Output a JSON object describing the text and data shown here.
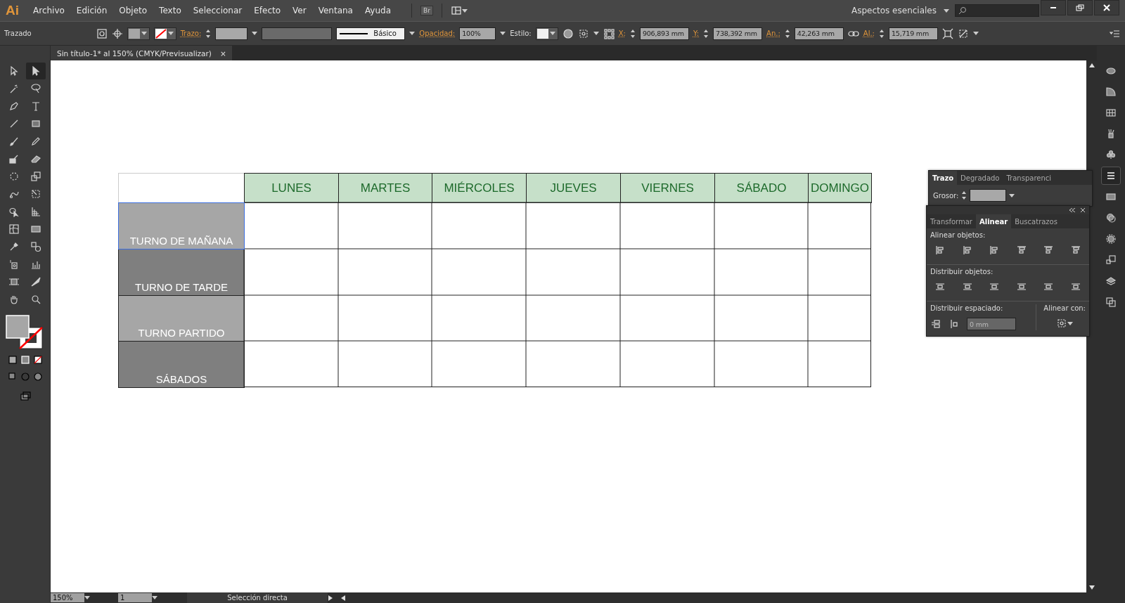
{
  "app": {
    "logo": "Ai",
    "menu": [
      "Archivo",
      "Edición",
      "Objeto",
      "Texto",
      "Seleccionar",
      "Efecto",
      "Ver",
      "Ventana",
      "Ayuda"
    ],
    "bridge": "Br",
    "workspace": "Aspectos esenciales"
  },
  "control_bar": {
    "selection": "Trazado",
    "stroke_label": "Trazo:",
    "preset": "Básico",
    "opacity_label": "Opacidad:",
    "opacity": "100%",
    "style_label": "Estilo:",
    "fields": [
      {
        "label": "X:",
        "value": "906,893 mm"
      },
      {
        "label": "Y:",
        "value": "738,392 mm"
      },
      {
        "label": "An.:",
        "value": "42,263 mm"
      },
      {
        "label": "Al.:",
        "value": "15,719 mm"
      }
    ]
  },
  "document_tab": {
    "title": "Sin título-1* al 150% (CMYK/Previsualizar)",
    "close": "×"
  },
  "tools": [
    {
      "kind": "selection",
      "selected": false
    },
    {
      "kind": "direct",
      "selected": true
    },
    {
      "kind": "wand",
      "selected": false
    },
    {
      "kind": "lasso",
      "selected": false
    },
    {
      "kind": "pen",
      "selected": false
    },
    {
      "kind": "type",
      "selected": false
    },
    {
      "kind": "line",
      "selected": false
    },
    {
      "kind": "rect",
      "selected": false
    },
    {
      "kind": "brush",
      "selected": false
    },
    {
      "kind": "pencil",
      "selected": false
    },
    {
      "kind": "blob",
      "selected": false
    },
    {
      "kind": "eraser",
      "selected": false
    },
    {
      "kind": "rotate",
      "selected": false
    },
    {
      "kind": "scale",
      "selected": false
    },
    {
      "kind": "warp",
      "selected": false
    },
    {
      "kind": "free",
      "selected": false
    },
    {
      "kind": "builder",
      "selected": false
    },
    {
      "kind": "perspective",
      "selected": false
    },
    {
      "kind": "mesh",
      "selected": false
    },
    {
      "kind": "gradient",
      "selected": false
    },
    {
      "kind": "eyedropper",
      "selected": false
    },
    {
      "kind": "blend",
      "selected": false
    },
    {
      "kind": "sprayer",
      "selected": false
    },
    {
      "kind": "graph",
      "selected": false
    },
    {
      "kind": "artboard",
      "selected": false
    },
    {
      "kind": "slice",
      "selected": false
    },
    {
      "kind": "hand",
      "selected": false
    },
    {
      "kind": "zoom",
      "selected": false
    }
  ],
  "table": {
    "columns": [
      "LUNES",
      "MARTES",
      "MIÉRCOLES",
      "JUEVES",
      "VIERNES",
      "SÁBADO",
      "DOMINGO"
    ],
    "rows": [
      {
        "label": "TURNO DE MAÑANA",
        "kind": "light",
        "selected": true
      },
      {
        "label": "TURNO DE TARDE",
        "kind": "dark",
        "selected": false
      },
      {
        "label": "TURNO PARTIDO",
        "kind": "light",
        "selected": false
      },
      {
        "label": "SÁBADOS",
        "kind": "dark",
        "selected": false
      }
    ]
  },
  "stroke_panel": {
    "tabs": [
      {
        "label": "Trazo",
        "selected": true
      },
      {
        "label": "Degradado",
        "selected": false
      },
      {
        "label": "Transparenci",
        "selected": false
      }
    ],
    "weight_label": "Grosor:"
  },
  "align_panel": {
    "tabs": [
      {
        "label": "Transformar",
        "selected": false
      },
      {
        "label": "Alinear",
        "selected": true
      },
      {
        "label": "Buscatrazos",
        "selected": false
      }
    ],
    "align_label": "Alinear objetos:",
    "distribute_label": "Distribuir objetos:",
    "spacing_label": "Distribuir espaciado:",
    "spacing_value": "0 mm",
    "align_to_label": "Alinear con:"
  },
  "dock": [
    {
      "kind": "palette",
      "selected": false
    },
    {
      "kind": "ramp",
      "selected": false
    },
    {
      "kind": "grid",
      "selected": false
    },
    {
      "kind": "brushes",
      "selected": false
    },
    {
      "kind": "club",
      "selected": false
    },
    {
      "kind": "lines",
      "selected": true
    },
    {
      "kind": "gradient",
      "selected": false
    },
    {
      "kind": "circles",
      "selected": false
    },
    {
      "kind": "dashed",
      "selected": false
    },
    {
      "kind": "squares",
      "selected": false
    },
    {
      "kind": "layers",
      "selected": false
    },
    {
      "kind": "artboards",
      "selected": false
    }
  ],
  "status_bar": {
    "zoom": "150%",
    "artboard": "1",
    "tool": "Selección directa"
  }
}
